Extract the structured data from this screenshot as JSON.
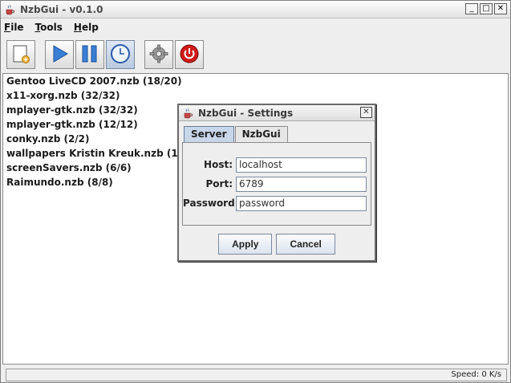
{
  "window": {
    "title": "NzbGui - v0.1.0",
    "controls": [
      "_",
      "□",
      "✕"
    ]
  },
  "menu": {
    "items": [
      {
        "label_first": "F",
        "label_rest": "ile"
      },
      {
        "label_first": "T",
        "label_rest": "ools"
      },
      {
        "label_first": "H",
        "label_rest": "elp"
      }
    ]
  },
  "toolbar": {
    "icons": [
      "new-file-icon",
      "play-icon",
      "pause-icon",
      "clock-icon",
      "gear-icon",
      "power-icon"
    ]
  },
  "downloads": [
    "Gentoo LiveCD 2007.nzb (18/20)",
    "x11-xorg.nzb (32/32)",
    "mplayer-gtk.nzb (32/32)",
    "mplayer-gtk.nzb (12/12)",
    "conky.nzb (2/2)",
    "wallpapers Kristin Kreuk.nzb (10/10)",
    "screenSavers.nzb (6/6)",
    "Raimundo.nzb (8/8)"
  ],
  "status": {
    "speed": "Speed: 0 K/s"
  },
  "settings_dialog": {
    "title": "NzbGui - Settings",
    "close": "✕",
    "tabs": [
      "Server",
      "NzbGui"
    ],
    "host_label": "Host:",
    "host_value": "localhost",
    "port_label": "Port:",
    "port_value": "6789",
    "password_label": "Password:",
    "password_value": "password",
    "apply_label": "Apply",
    "cancel_label": "Cancel"
  },
  "colors": {
    "accent": "#3a6fc4",
    "power": "#d11a1a"
  }
}
